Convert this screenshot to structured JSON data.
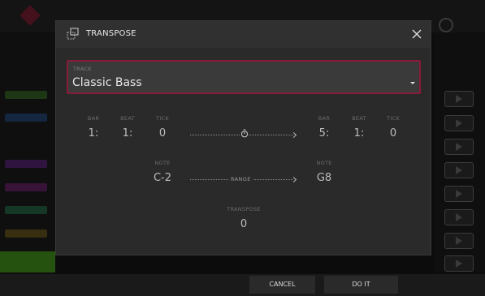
{
  "dialog": {
    "title": "TRANSPOSE",
    "track_label": "TRACK",
    "track_value": "Classic Bass",
    "bar_label": "BAR",
    "beat_label": "BEAT",
    "tick_label": "TICK",
    "start": {
      "bar": "1:",
      "beat": "1:",
      "tick": "0"
    },
    "end": {
      "bar": "5:",
      "beat": "1:",
      "tick": "0"
    },
    "note_label": "NOTE",
    "note_low": "C-2",
    "note_high": "G8",
    "range_label": "RANGE",
    "transpose_label": "TRANSPOSE",
    "transpose_value": "0"
  },
  "footer": {
    "cancel_label": "CANCEL",
    "doit_label": "DO IT"
  },
  "colors": {
    "accent": "#8a1a3a",
    "dialog_bg": "#2a2a2a"
  }
}
